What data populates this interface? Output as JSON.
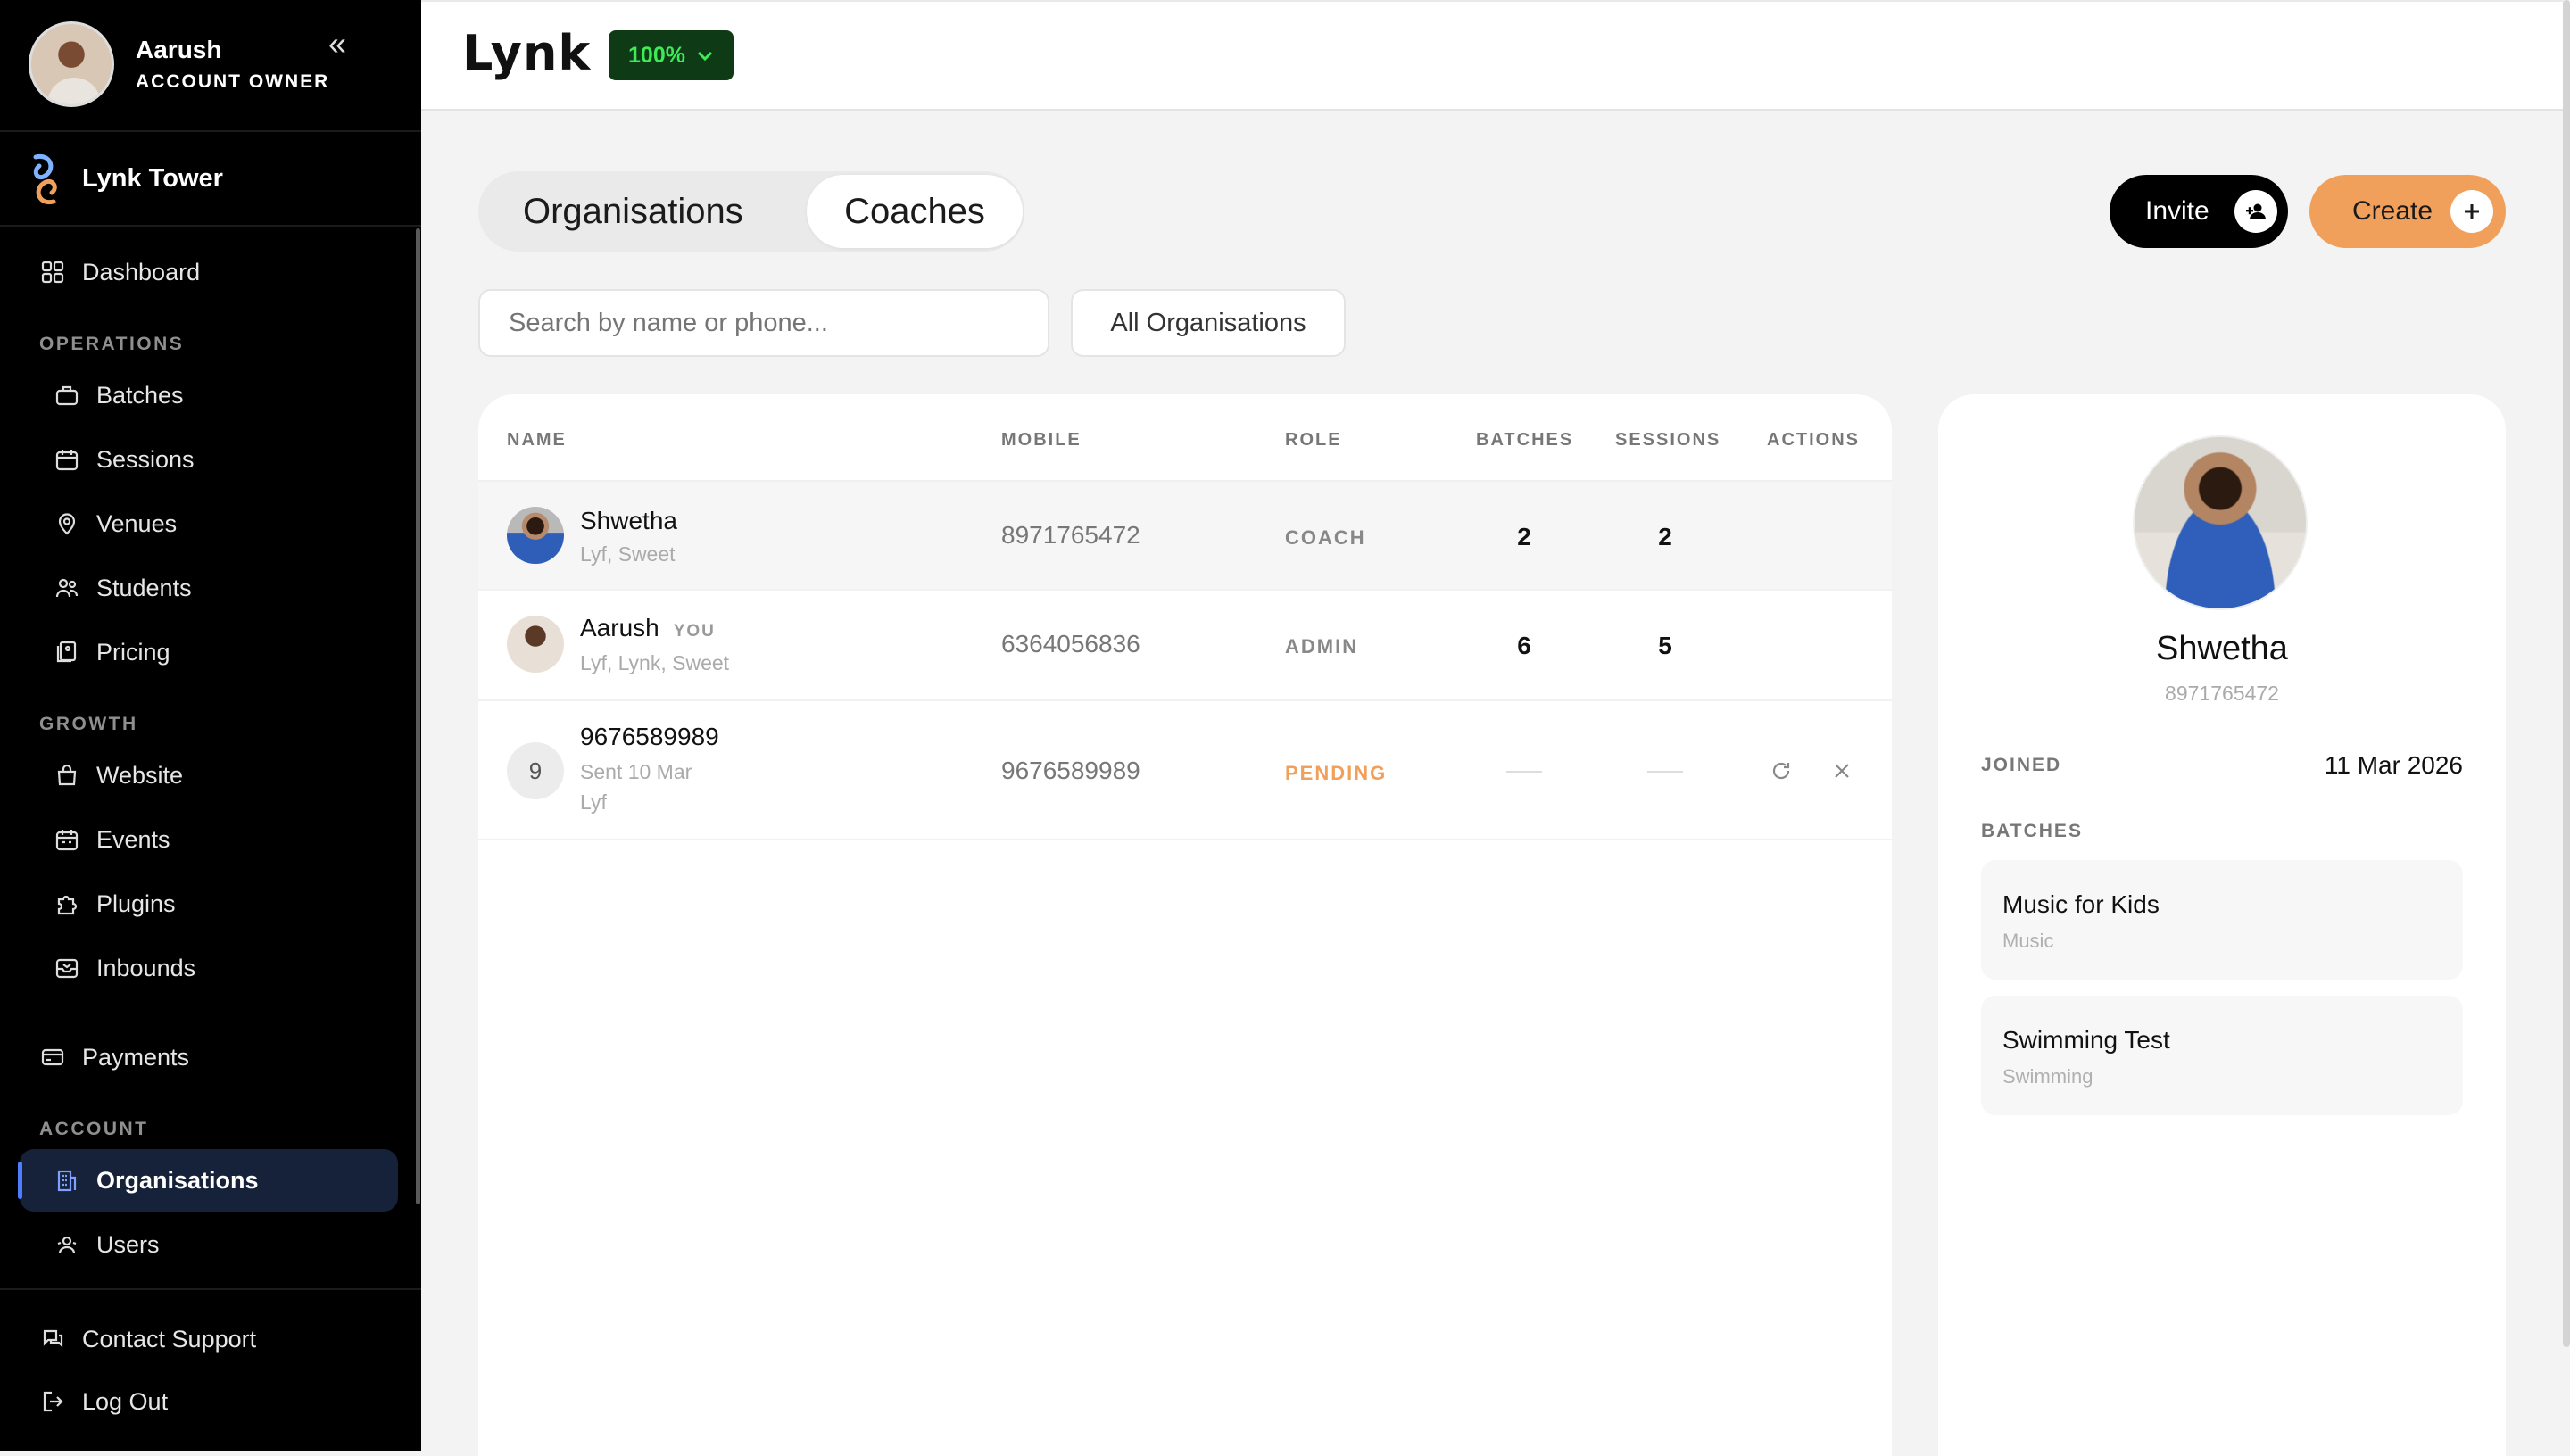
{
  "user": {
    "name": "Aarush",
    "role": "ACCOUNT OWNER"
  },
  "brand": {
    "name": "Lynk Tower"
  },
  "nav": {
    "dashboard": "Dashboard",
    "operations_label": "OPERATIONS",
    "operations": [
      "Batches",
      "Sessions",
      "Venues",
      "Students",
      "Pricing"
    ],
    "growth_label": "GROWTH",
    "growth": [
      "Website",
      "Events",
      "Plugins",
      "Inbounds"
    ],
    "payments": "Payments",
    "account_label": "ACCOUNT",
    "account": [
      "Organisations",
      "Users"
    ],
    "contact_support": "Contact Support",
    "logout": "Log Out"
  },
  "topbar": {
    "logo": "Lynk",
    "zoom": "100%"
  },
  "tabs": {
    "organisations": "Organisations",
    "coaches": "Coaches",
    "active": "Coaches"
  },
  "actions": {
    "invite": "Invite",
    "create": "Create"
  },
  "filters": {
    "search_placeholder": "Search by name or phone...",
    "org_filter": "All Organisations"
  },
  "table": {
    "headers": {
      "name": "NAME",
      "mobile": "MOBILE",
      "role": "ROLE",
      "batches": "BATCHES",
      "sessions": "SESSIONS",
      "actions": "ACTIONS"
    },
    "rows": [
      {
        "name": "Shwetha",
        "orgs": "Lyf, Sweet",
        "mobile": "8971765472",
        "role": "COACH",
        "batches": "2",
        "sessions": "2"
      },
      {
        "name": "Aarush",
        "you": "YOU",
        "orgs": "Lyf, Lynk, Sweet",
        "mobile": "6364056836",
        "role": "ADMIN",
        "batches": "6",
        "sessions": "5"
      },
      {
        "name": "9676589989",
        "initial": "9",
        "sent": "Sent 10 Mar",
        "orgs": "Lyf",
        "mobile": "9676589989",
        "role": "PENDING"
      }
    ]
  },
  "detail": {
    "name": "Shwetha",
    "phone": "8971765472",
    "joined_label": "JOINED",
    "joined_value": "11 Mar 2026",
    "batches_label": "BATCHES",
    "batches": [
      {
        "title": "Music for Kids",
        "subtitle": "Music"
      },
      {
        "title": "Swimming Test",
        "subtitle": "Swimming"
      }
    ]
  },
  "colors": {
    "accent_orange": "#f0a05a",
    "active_blue": "#4f7dff",
    "zoom_green": "#3eea55",
    "sidebar_bg": "#000000"
  }
}
